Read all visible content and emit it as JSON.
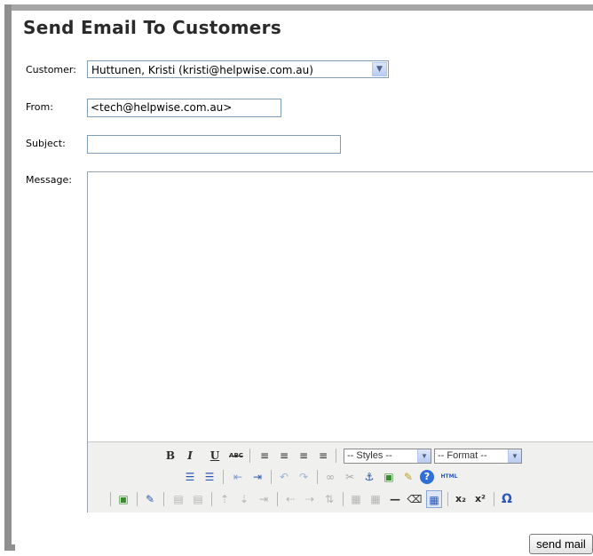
{
  "page": {
    "title": "Send Email To Customers"
  },
  "form": {
    "customer_label": "Customer:",
    "customer_value": "Huttunen, Kristi (kristi@helpwise.com.au)",
    "from_label": "From:",
    "from_value": "<tech@helpwise.com.au>",
    "subject_label": "Subject:",
    "subject_value": "",
    "message_label": "Message:",
    "message_value": ""
  },
  "toolbar": {
    "row1": {
      "bold": "B",
      "italic": "I",
      "underline": "U",
      "strike": "ABC",
      "align_left": "≡",
      "align_center": "≡",
      "align_right": "≡",
      "align_justify": "≡",
      "styles": "-- Styles --",
      "format": "-- Format --"
    },
    "row2": {
      "bullets": "☰",
      "numbers": "☰",
      "outdent": "⇤",
      "indent": "⇥",
      "undo": "↶",
      "redo": "↷",
      "link": "∞",
      "unlink": "✂",
      "anchor": "⚓",
      "image": "▣",
      "cleanup": "✎",
      "help": "?",
      "html": "HTML"
    },
    "row3": {
      "insert_hr": "—",
      "eraser": "⌫",
      "subscript": "x₂",
      "superscript": "x²",
      "charmap": "Ω"
    }
  },
  "actions": {
    "send_label": "send mail"
  },
  "colors": {
    "frame": "#8f8f8f",
    "input_border": "#7f9db9",
    "toolbar_bg": "#f0f0ee"
  }
}
